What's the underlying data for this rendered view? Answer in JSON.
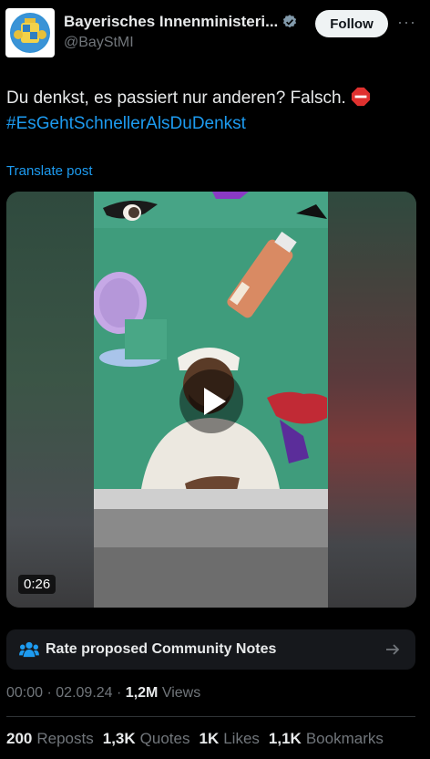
{
  "header": {
    "display_name": "Bayerisches Innenministeri...",
    "handle": "@BayStMI",
    "follow_label": "Follow",
    "more_label": "···"
  },
  "post": {
    "text": "Du denkst, es passiert nur anderen? Falsch.",
    "hashtag": "#EsGehtSchnellerAlsDuDenkst",
    "translate_label": "Translate post"
  },
  "video": {
    "duration": "0:26"
  },
  "community_notes": {
    "label": "Rate proposed Community Notes"
  },
  "meta": {
    "time": "00:00",
    "separator": "·",
    "date": "02.09.24",
    "views_count": "1,2M",
    "views_label": "Views"
  },
  "stats": {
    "reposts_count": "200",
    "reposts_label": "Reposts",
    "quotes_count": "1,3K",
    "quotes_label": "Quotes",
    "likes_count": "1K",
    "likes_label": "Likes",
    "bookmarks_count": "1,1K",
    "bookmarks_label": "Bookmarks"
  },
  "colors": {
    "accent": "#1d9bf0",
    "background": "#000000",
    "text_primary": "#e7e9ea",
    "text_secondary": "#71767b"
  }
}
